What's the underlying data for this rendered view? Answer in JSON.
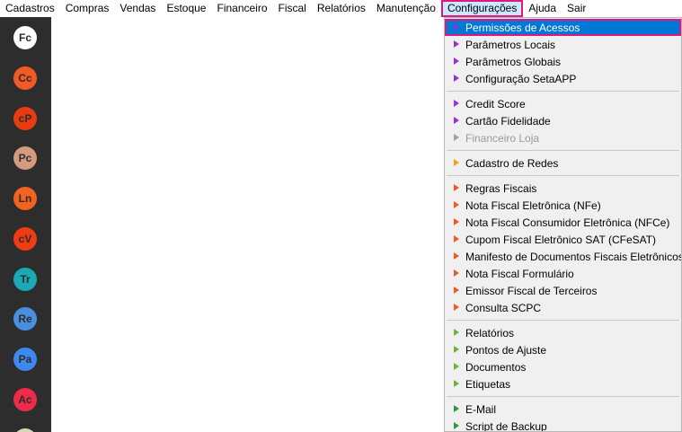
{
  "menubar": {
    "items": [
      "Cadastros",
      "Compras",
      "Vendas",
      "Estoque",
      "Financeiro",
      "Fiscal",
      "Relatórios",
      "Manutenção",
      "Configurações",
      "Ajuda",
      "Sair"
    ],
    "active": "Configurações"
  },
  "sidebar": {
    "buttons": [
      {
        "label": "Fc",
        "color": "#ffffff",
        "text_color": "#2d2d2d"
      },
      {
        "label": "Cc",
        "color": "#f15a24",
        "text_color": "#2d2d2d"
      },
      {
        "label": "cP",
        "color": "#e83b0f",
        "text_color": "#2d2d2d"
      },
      {
        "label": "Pc",
        "color": "#d49a7e",
        "text_color": "#2d2d2d"
      },
      {
        "label": "Ln",
        "color": "#f26322",
        "text_color": "#2d2d2d"
      },
      {
        "label": "cV",
        "color": "#f03c12",
        "text_color": "#2d2d2d"
      },
      {
        "label": "Tr",
        "color": "#1aa9b5",
        "text_color": "#2d2d2d"
      },
      {
        "label": "Re",
        "color": "#4a8ee0",
        "text_color": "#2d2d2d"
      },
      {
        "label": "Pa",
        "color": "#3f88f0",
        "text_color": "#2d2d2d"
      },
      {
        "label": "Ac",
        "color": "#ef2b4a",
        "text_color": "#2d2d2d"
      }
    ]
  },
  "dropdown": {
    "groups": [
      {
        "color": "#9b2fd1",
        "items": [
          {
            "label": "Permissões de Acessos",
            "selected": true
          },
          {
            "label": "Parâmetros Locais"
          },
          {
            "label": "Parâmetros Globais"
          },
          {
            "label": "Configuração SetaAPP"
          }
        ]
      },
      {
        "color": "#9b2fd1",
        "items": [
          {
            "label": "Credit Score"
          },
          {
            "label": "Cartão Fidelidade"
          },
          {
            "label": "Financeiro Loja",
            "disabled": true
          }
        ]
      },
      {
        "color": "#f0a21e",
        "items": [
          {
            "label": "Cadastro de Redes"
          }
        ]
      },
      {
        "color": "#f05a23",
        "items": [
          {
            "label": "Regras Fiscais"
          },
          {
            "label": "Nota Fiscal Eletrônica (NFe)"
          },
          {
            "label": "Nota Fiscal Consumidor Eletrônica (NFCe)"
          },
          {
            "label": "Cupom Fiscal Eletrônico SAT (CFeSAT)"
          },
          {
            "label": "Manifesto de Documentos Fiscais Eletrônicos"
          },
          {
            "label": "Nota Fiscal Formulário"
          },
          {
            "label": "Emissor Fiscal de Terceiros"
          },
          {
            "label": "Consulta SCPC"
          }
        ]
      },
      {
        "color": "#6fb23a",
        "items": [
          {
            "label": "Relatórios"
          },
          {
            "label": "Pontos de Ajuste"
          },
          {
            "label": "Documentos"
          },
          {
            "label": "Etiquetas"
          }
        ]
      },
      {
        "color": "#2a9a3a",
        "items": [
          {
            "label": "E-Mail"
          },
          {
            "label": "Script de Backup"
          }
        ]
      }
    ],
    "selected_arrow_color": "#9b2fd1",
    "disabled_arrow_color": "#a0a0a0"
  }
}
